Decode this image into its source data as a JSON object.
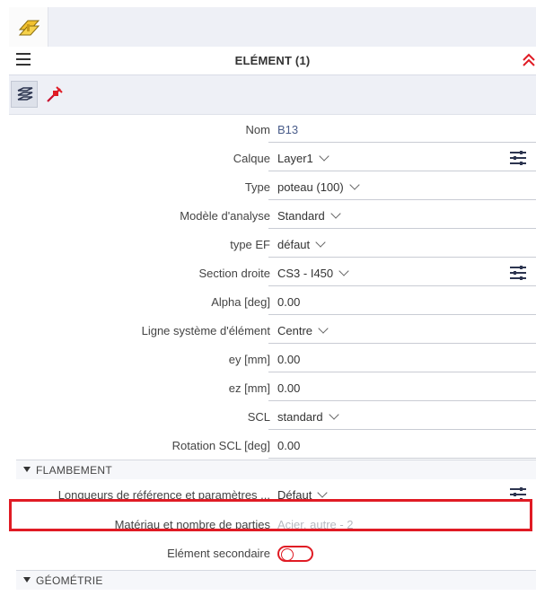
{
  "header": {
    "title": "ELÉMENT (1)"
  },
  "icons": {
    "app_logo": "beam-logo-icon",
    "menu": "hamburger-menu-icon",
    "collapse": "double-chevron-up-icon",
    "layers": "layers-icon",
    "pin": "pin-node-icon",
    "settings": "sliders-settings-icon"
  },
  "properties": [
    {
      "label": "Nom",
      "value": "B13",
      "kind": "text"
    },
    {
      "label": "Calque",
      "value": "Layer1",
      "kind": "dropdown",
      "settings": true
    },
    {
      "label": "Type",
      "value": "poteau (100)",
      "kind": "dropdown"
    },
    {
      "label": "Modèle d'analyse",
      "value": "Standard",
      "kind": "dropdown"
    },
    {
      "label": "type EF",
      "value": "défaut",
      "kind": "dropdown"
    },
    {
      "label": "Section droite",
      "value": "CS3 - I450",
      "kind": "dropdown",
      "settings": true
    },
    {
      "label": "Alpha [deg]",
      "value": "0.00",
      "kind": "text"
    },
    {
      "label": "Ligne système d'élément",
      "value": "Centre",
      "kind": "dropdown"
    },
    {
      "label": "ey [mm]",
      "value": "0.00",
      "kind": "text"
    },
    {
      "label": "ez [mm]",
      "value": "0.00",
      "kind": "text"
    },
    {
      "label": "SCL",
      "value": "standard",
      "kind": "dropdown"
    },
    {
      "label": "Rotation SCL [deg]",
      "value": "0.00",
      "kind": "text"
    }
  ],
  "flambement": {
    "title": "FLAMBEMENT",
    "rows": [
      {
        "label": "Longueurs de référence et paramètres ...",
        "value": "Défaut"
      },
      {
        "label": "Matériau et nombre de parties",
        "value": "Acier, autre - 2"
      },
      {
        "label": "Elément secondaire",
        "value": "off"
      }
    ]
  },
  "geometrie": {
    "title": "GÉOMÉTRIE"
  },
  "colors": {
    "accent_red": "#e01b24",
    "panel_bg": "#eef0f6",
    "value_text": "#4a5d8a"
  }
}
